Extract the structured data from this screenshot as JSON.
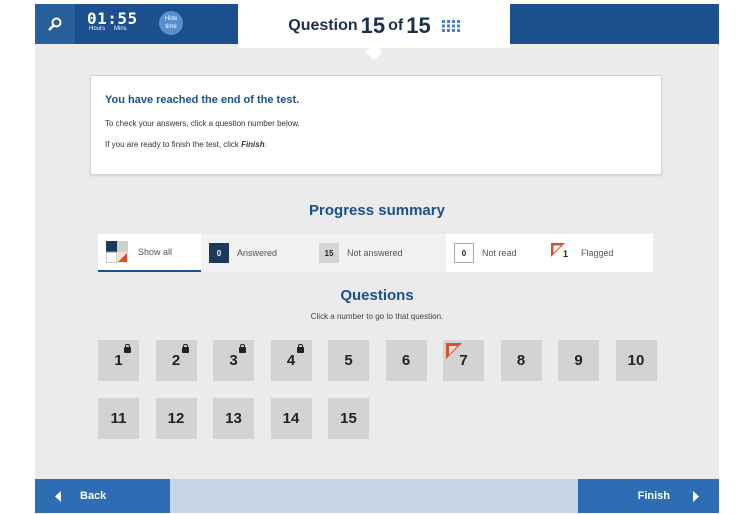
{
  "timer": {
    "time": "01:55",
    "hours_label": "Hours",
    "mins_label": "Mins",
    "hide_label": "Hide time"
  },
  "header": {
    "question_word": "Question",
    "current": "15",
    "of_word": "of",
    "total": "15"
  },
  "info": {
    "title": "You have reached the end of the test.",
    "line1": "To check your answers, click a question number below.",
    "line2_prefix": "If you are ready to finish the test, click ",
    "line2_finish": "Finish",
    "line2_suffix": "."
  },
  "progress": {
    "title": "Progress summary",
    "show_all": "Show all",
    "answered_count": "0",
    "answered_label": "Answered",
    "not_answered_count": "15",
    "not_answered_label": "Not answered",
    "not_read_count": "0",
    "not_read_label": "Not read",
    "flagged_count": "1",
    "flagged_label": "Flagged"
  },
  "questions": {
    "title": "Questions",
    "hint": "Click a number to go to that question.",
    "items": [
      {
        "n": "1",
        "locked": true,
        "flagged": false
      },
      {
        "n": "2",
        "locked": true,
        "flagged": false
      },
      {
        "n": "3",
        "locked": true,
        "flagged": false
      },
      {
        "n": "4",
        "locked": true,
        "flagged": false
      },
      {
        "n": "5",
        "locked": false,
        "flagged": false
      },
      {
        "n": "6",
        "locked": false,
        "flagged": false
      },
      {
        "n": "7",
        "locked": false,
        "flagged": true
      },
      {
        "n": "8",
        "locked": false,
        "flagged": false
      },
      {
        "n": "9",
        "locked": false,
        "flagged": false
      },
      {
        "n": "10",
        "locked": false,
        "flagged": false
      },
      {
        "n": "11",
        "locked": false,
        "flagged": false
      },
      {
        "n": "12",
        "locked": false,
        "flagged": false
      },
      {
        "n": "13",
        "locked": false,
        "flagged": false
      },
      {
        "n": "14",
        "locked": false,
        "flagged": false
      },
      {
        "n": "15",
        "locked": false,
        "flagged": false
      }
    ]
  },
  "footer": {
    "back_label": "Back",
    "finish_label": "Finish"
  },
  "colors": {
    "primary": "#1b4f8e",
    "button_blue": "#2e6db4",
    "flag_red": "#d9502f"
  }
}
